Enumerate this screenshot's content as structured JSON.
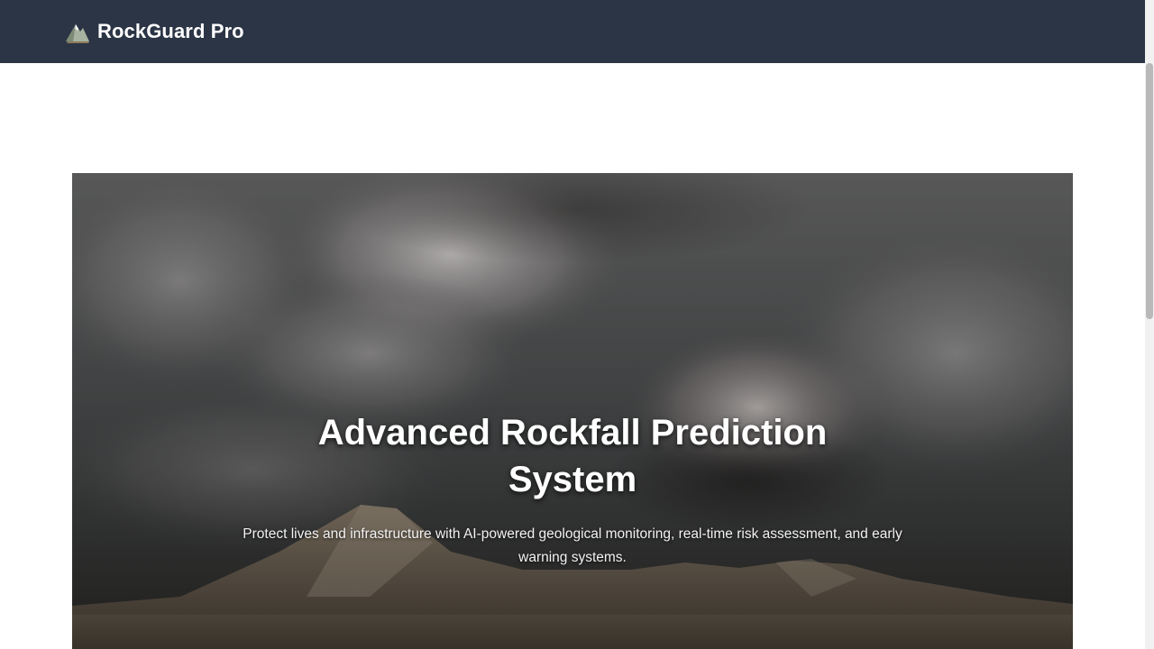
{
  "navbar": {
    "brand_name": "RockGuard Pro",
    "brand_icon": "mountain-icon",
    "background": "#2b3545"
  },
  "hero": {
    "title": "Advanced Rockfall Prediction System",
    "subtitle": "Protect lives and infrastructure with AI-powered geological monitoring, real-time risk assessment, and early warning systems.",
    "image": "storm-clouds-over-mountains"
  }
}
